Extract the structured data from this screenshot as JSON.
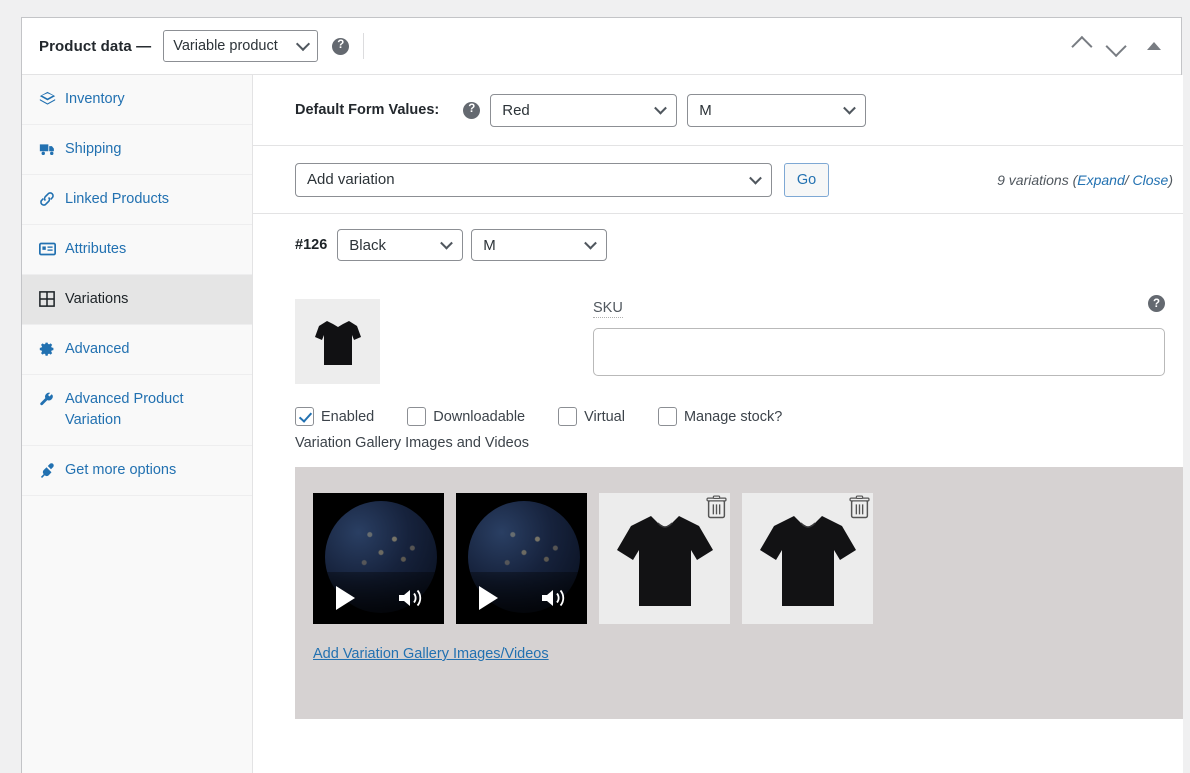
{
  "header": {
    "title": "Product data —",
    "product_type": "Variable product",
    "help_icon": "help-icon",
    "collapse_up": "chevron-up-icon",
    "collapse_down": "chevron-down-icon",
    "toggle": "triangle-up-icon"
  },
  "sidebar": {
    "items": [
      {
        "label": "Inventory",
        "icon": "inventory-icon",
        "active": false
      },
      {
        "label": "Shipping",
        "icon": "shipping-truck-icon",
        "active": false
      },
      {
        "label": "Linked Products",
        "icon": "link-icon",
        "active": false
      },
      {
        "label": "Attributes",
        "icon": "attributes-icon",
        "active": false
      },
      {
        "label": "Variations",
        "icon": "grid-icon",
        "active": true
      },
      {
        "label": "Advanced",
        "icon": "gear-icon",
        "active": false
      },
      {
        "label": "Advanced Product Variation",
        "icon": "wrench-icon",
        "active": false
      },
      {
        "label": "Get more options",
        "icon": "plug-icon",
        "active": false
      }
    ]
  },
  "default_form_values": {
    "label": "Default Form Values:",
    "help_icon": "help-icon",
    "color": "Red",
    "size": "M"
  },
  "add_variation": {
    "select_value": "Add variation",
    "go_label": "Go",
    "count_text": "9 variations",
    "expand_label": "Expand",
    "separator": "/",
    "close_label": "Close"
  },
  "variation": {
    "id": "#126",
    "color": "Black",
    "size": "M",
    "thumbnail": "black-tshirt-thumbnail",
    "sku_label": "SKU",
    "sku_value": "",
    "sku_placeholder": "",
    "sku_help_icon": "help-icon",
    "checkboxes": [
      {
        "label": "Enabled",
        "checked": true
      },
      {
        "label": "Downloadable",
        "checked": false
      },
      {
        "label": "Virtual",
        "checked": false
      },
      {
        "label": "Manage stock?",
        "checked": false
      }
    ],
    "gallery_title": "Variation Gallery Images and Videos",
    "gallery_items": [
      {
        "type": "video",
        "name": "earth-night-video-thumbnail",
        "deletable": false
      },
      {
        "type": "video",
        "name": "earth-night-video-thumbnail",
        "deletable": false
      },
      {
        "type": "image",
        "name": "black-tshirt-image",
        "deletable": true
      },
      {
        "type": "image",
        "name": "black-tshirt-image",
        "deletable": true
      }
    ],
    "add_gallery_link": "Add Variation Gallery Images/Videos"
  },
  "colors": {
    "link": "#2271b1",
    "active_bg": "#e5e5e5",
    "gallery_bg": "#d6d2d2",
    "panel_bg": "#ffffff",
    "page_bg": "#f0f0f1"
  }
}
